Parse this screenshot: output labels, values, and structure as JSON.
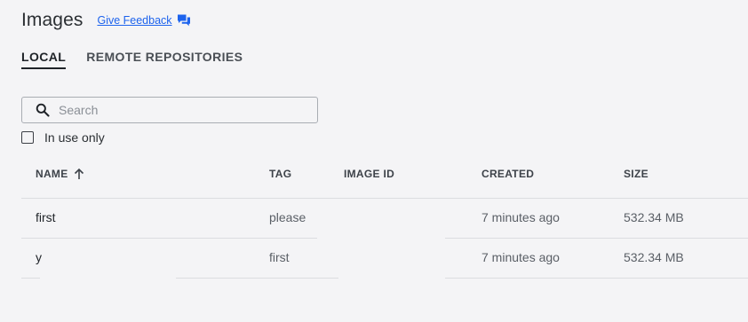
{
  "header": {
    "title": "Images",
    "feedback_label": "Give Feedback",
    "feedback_icon": "chat-bubbles-icon"
  },
  "tabs": [
    {
      "label": "LOCAL",
      "active": true
    },
    {
      "label": "REMOTE REPOSITORIES",
      "active": false
    }
  ],
  "search": {
    "placeholder": "Search",
    "value": "",
    "icon": "search-icon"
  },
  "filter": {
    "in_use_label": "In use only",
    "checked": false
  },
  "table": {
    "columns": {
      "name": "NAME",
      "tag": "TAG",
      "image_id": "IMAGE ID",
      "created": "CREATED",
      "size": "SIZE"
    },
    "sort_icon": "arrow-up-icon",
    "rows": [
      {
        "name": "first",
        "tag": "please",
        "image_id": "",
        "created": "7 minutes ago",
        "size": "532.34 MB"
      },
      {
        "name": "y",
        "tag": "first",
        "image_id": "",
        "created": "7 minutes ago",
        "size": "532.34 MB"
      }
    ]
  },
  "colors": {
    "accent": "#1d63ed",
    "background": "#f4f4f6",
    "divider": "#dcdde0"
  }
}
